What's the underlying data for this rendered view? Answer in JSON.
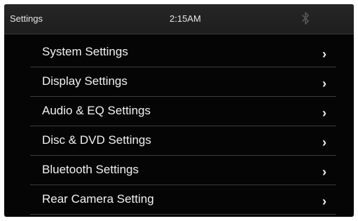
{
  "status_bar": {
    "title": "Settings",
    "clock": "2:15AM",
    "bluetooth_icon": "bluetooth-icon"
  },
  "menu": {
    "items": [
      {
        "label": "System Settings",
        "chevron": "›"
      },
      {
        "label": "Display Settings",
        "chevron": "›"
      },
      {
        "label": "Audio & EQ Settings",
        "chevron": "›"
      },
      {
        "label": "Disc & DVD Settings",
        "chevron": "›"
      },
      {
        "label": "Bluetooth Settings",
        "chevron": "›"
      },
      {
        "label": "Rear Camera Setting",
        "chevron": "›"
      }
    ]
  },
  "colors": {
    "screen_bg": "#050505",
    "status_bar_bg": "#222222",
    "text": "#f2f2f2",
    "divider": "#3d3d3d",
    "bluetooth_icon": "#555555"
  }
}
